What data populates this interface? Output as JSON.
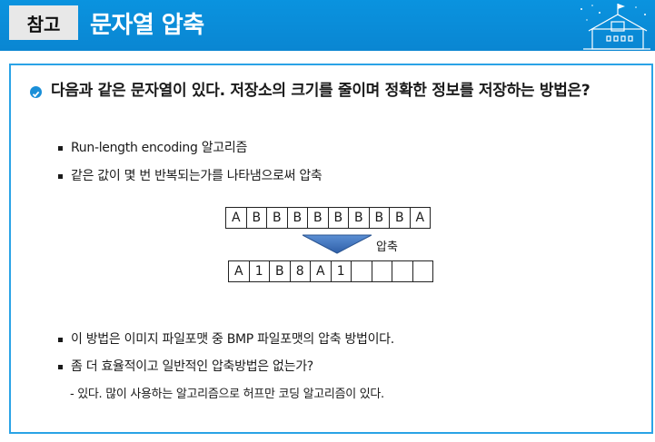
{
  "header": {
    "tag": "참고",
    "title": "문자열 압축"
  },
  "question": {
    "text": "다음과 같은 문자열이 있다. 저장소의 크기를 줄이며 정확한 정보를 저장하는 방법은?"
  },
  "bullets": [
    "Run-length encoding 알고리즘",
    "같은 값이 몇 번 반복되는가를 나타냄으로써 압축",
    "이 방법은 이미지 파일포맷 중 BMP 파일포맷의 압축 방법이다.",
    "좀 더 효율적이고 일반적인 압축방법은 없는가?"
  ],
  "answer": "- 있다. 많이 사용하는 알고리즘으로 허프만 코딩 알고리즘이 있다.",
  "diagram": {
    "input_cells": [
      "A",
      "B",
      "B",
      "B",
      "B",
      "B",
      "B",
      "B",
      "B",
      "A"
    ],
    "output_cells": [
      "A",
      "1",
      "B",
      "8",
      "A",
      "1",
      "",
      "",
      "",
      ""
    ],
    "arrow_label": "압축"
  },
  "colors": {
    "banner": "#0a8fd8",
    "panel_border": "#2aa3e6",
    "arrow": "#3b6fb8"
  }
}
